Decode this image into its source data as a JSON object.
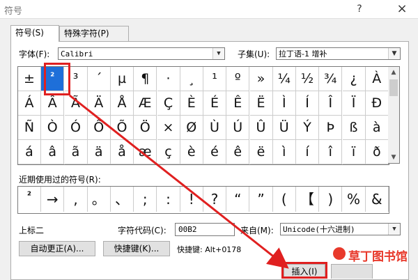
{
  "dialog": {
    "title": "符号",
    "help_icon": "?",
    "close_icon": "×"
  },
  "tabs": [
    {
      "label": "符号(S)"
    },
    {
      "label": "特殊字符(P)"
    }
  ],
  "font": {
    "label": "字体(F):",
    "value": "Calibri"
  },
  "subset": {
    "label": "子集(U):",
    "value": "拉丁语-1 增补"
  },
  "symbol_grid": {
    "rows": [
      [
        "±",
        "²",
        "³",
        "´",
        "µ",
        "¶",
        "·",
        "¸",
        "¹",
        "º",
        "»",
        "¼",
        "½",
        "¾",
        "¿",
        "À"
      ],
      [
        "Á",
        "Â",
        "Ã",
        "Ä",
        "Å",
        "Æ",
        "Ç",
        "È",
        "É",
        "Ê",
        "Ë",
        "Ì",
        "Í",
        "Î",
        "Ï",
        "Ð"
      ],
      [
        "Ñ",
        "Ò",
        "Ó",
        "Ô",
        "Õ",
        "Ö",
        "×",
        "Ø",
        "Ù",
        "Ú",
        "Û",
        "Ü",
        "Ý",
        "Þ",
        "ß",
        "à"
      ],
      [
        "á",
        "â",
        "ã",
        "ä",
        "å",
        "æ",
        "ç",
        "è",
        "é",
        "ê",
        "ë",
        "ì",
        "í",
        "î",
        "ï",
        "ð"
      ]
    ]
  },
  "recent": {
    "label": "近期使用过的符号(R):",
    "symbols": [
      "²",
      "→",
      ",",
      "。",
      "、",
      ";",
      ":",
      "!",
      "?",
      "“",
      "”",
      "(",
      "【",
      ")",
      "%",
      "&"
    ]
  },
  "char_name": "上标二",
  "char_code": {
    "label": "字符代码(C):",
    "value": "00B2"
  },
  "from": {
    "label": "来自(M):",
    "value": "Unicode(十六进制)"
  },
  "buttons": {
    "autocorrect": "自动更正(A)...",
    "shortcut_key": "快捷键(K)...",
    "shortcut_text": "快捷键: Alt+0178",
    "insert": "插入(I)"
  },
  "watermark": "草丁图书馆",
  "colors": {
    "selection": "#1e6fd9",
    "annotation": "#e02020",
    "watermark": "#e8392b"
  }
}
